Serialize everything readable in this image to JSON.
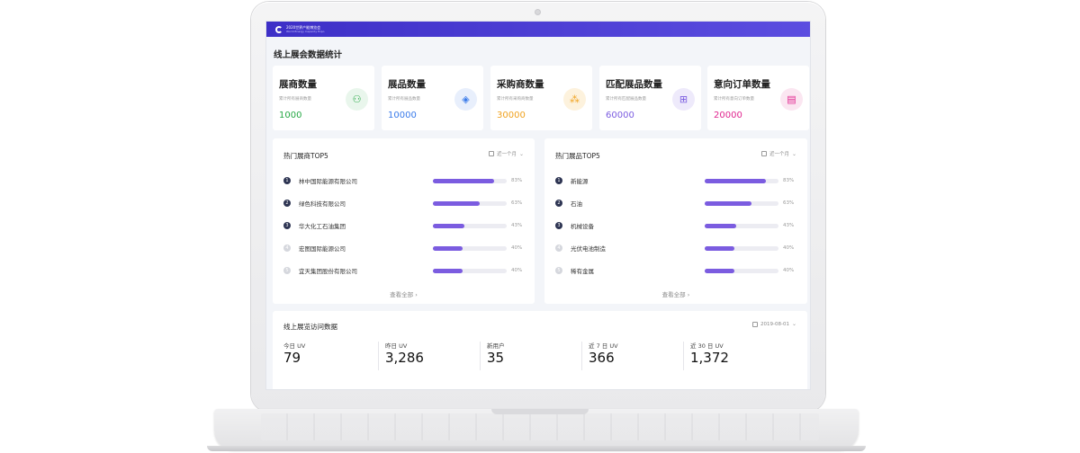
{
  "app": {
    "logo_title": "2020世界产能博览会",
    "logo_subtitle": "World Energy Capacity Expo"
  },
  "page_title": "线上展会数据统计",
  "stats": [
    {
      "title": "展商数量",
      "desc": "累计所有展商数量",
      "value": "1000",
      "color": "#26a845",
      "icon": "exhibitor-icon",
      "icon_bg": "#e9f6ec",
      "glyph": "⚇"
    },
    {
      "title": "展品数量",
      "desc": "累计所有展品数量",
      "value": "10000",
      "color": "#3a7bea",
      "icon": "layers-icon",
      "icon_bg": "#e8effc",
      "glyph": "◈"
    },
    {
      "title": "采购商数量",
      "desc": "累计所有采购商数量",
      "value": "30000",
      "color": "#f0a21f",
      "icon": "group-icon",
      "icon_bg": "#fdf2dd",
      "glyph": "⁂"
    },
    {
      "title": "匹配展品数量",
      "desc": "累计所有匹配展品数量",
      "value": "60000",
      "color": "#7b5ce0",
      "icon": "match-icon",
      "icon_bg": "#eeeafb",
      "glyph": "⊞"
    },
    {
      "title": "意向订单数量",
      "desc": "累计所有意向订单数量",
      "value": "20000",
      "color": "#e0268f",
      "icon": "order-icon",
      "icon_bg": "#fbe6f1",
      "glyph": "▤"
    }
  ],
  "hot_exhibitors": {
    "title": "热门展商TOP5",
    "period": "近一个月",
    "view_all": "查看全部",
    "items": [
      {
        "rank": "1",
        "name": "林中国际能源有限公司",
        "percent": 83,
        "pct_label": "83%"
      },
      {
        "rank": "2",
        "name": "绿色科技有限公司",
        "percent": 63,
        "pct_label": "63%"
      },
      {
        "rank": "3",
        "name": "华大化工石油集团",
        "percent": 43,
        "pct_label": "43%"
      },
      {
        "rank": "4",
        "name": "宏图国际能源公司",
        "percent": 40,
        "pct_label": "40%"
      },
      {
        "rank": "5",
        "name": "宜天集团股份有限公司",
        "percent": 40,
        "pct_label": "40%"
      }
    ]
  },
  "hot_products": {
    "title": "热门展品TOP5",
    "period": "近一个月",
    "view_all": "查看全部",
    "items": [
      {
        "rank": "1",
        "name": "新能源",
        "percent": 83,
        "pct_label": "83%"
      },
      {
        "rank": "2",
        "name": "石油",
        "percent": 63,
        "pct_label": "63%"
      },
      {
        "rank": "3",
        "name": "机械设备",
        "percent": 43,
        "pct_label": "43%"
      },
      {
        "rank": "4",
        "name": "光伏电池制造",
        "percent": 40,
        "pct_label": "40%"
      },
      {
        "rank": "5",
        "name": "稀有金属",
        "percent": 40,
        "pct_label": "40%"
      }
    ]
  },
  "visits": {
    "title": "线上展览访问数据",
    "date": "2019-08-01",
    "metrics": [
      {
        "label": "今日 UV",
        "value": "79"
      },
      {
        "label": "昨日 UV",
        "value": "3,286"
      },
      {
        "label": "新用户",
        "value": "35"
      },
      {
        "label": "近 7 日 UV",
        "value": "366"
      },
      {
        "label": "近 30 日 UV",
        "value": "1,372"
      }
    ]
  },
  "colors": {
    "accent": "#7b5ce0",
    "topbar": "#4537d2",
    "rank_top": "#2d3452"
  }
}
